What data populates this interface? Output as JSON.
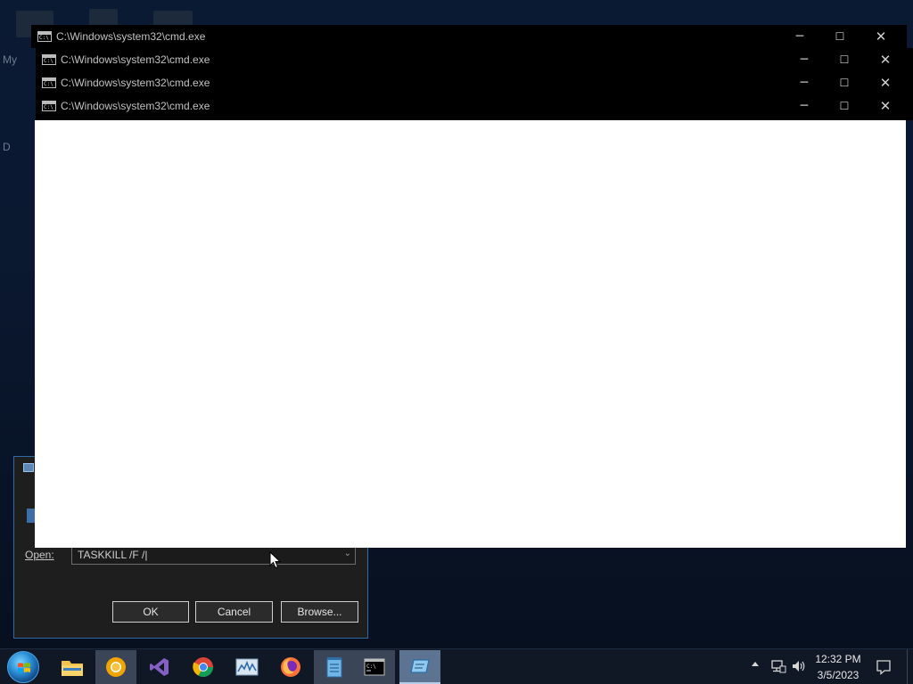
{
  "desktop": {
    "fragments": [
      "My",
      "D"
    ]
  },
  "run_dialog": {
    "open_label": "Open:",
    "input_value": "TASKKILL /F /|",
    "ok_label": "OK",
    "cancel_label": "Cancel",
    "browse_label": "Browse..."
  },
  "cmd_windows": [
    {
      "title": "C:\\Windows\\system32\\cmd.exe"
    },
    {
      "title": "C:\\Windows\\system32\\cmd.exe"
    },
    {
      "title": "C:\\Windows\\system32\\cmd.exe"
    },
    {
      "title": "C:\\Windows\\system32\\cmd.exe"
    }
  ],
  "window_controls": {
    "minimize": "─",
    "maximize": "☐",
    "close": "✕"
  },
  "taskbar": {
    "apps": [
      {
        "name": "File Explorer",
        "icon": "folder-icon"
      },
      {
        "name": "Chrome Canary",
        "icon": "chrome-canary-icon"
      },
      {
        "name": "Visual Studio",
        "icon": "visual-studio-icon"
      },
      {
        "name": "Google Chrome",
        "icon": "chrome-icon"
      },
      {
        "name": "Resource Monitor",
        "icon": "resource-monitor-icon"
      },
      {
        "name": "Firefox",
        "icon": "firefox-icon"
      },
      {
        "name": "Notepad",
        "icon": "notepad-icon"
      },
      {
        "name": "Command Prompt",
        "icon": "cmd-icon"
      },
      {
        "name": "Run",
        "icon": "run-icon"
      }
    ],
    "clock_time": "12:32 PM",
    "clock_date": "3/5/2023"
  }
}
